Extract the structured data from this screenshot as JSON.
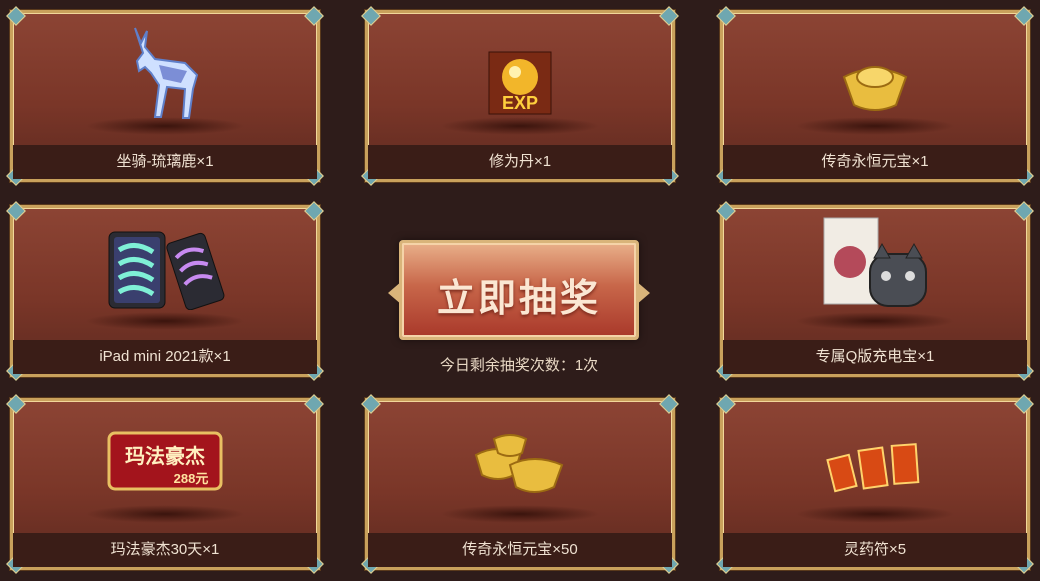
{
  "prizes": [
    {
      "label": "坐骑-琉璃鹿×1",
      "icon": "crystal-deer-icon"
    },
    {
      "label": "修为丹×1",
      "icon": "exp-pill-icon"
    },
    {
      "label": "传奇永恒元宝×1",
      "icon": "gold-ingot-icon"
    },
    {
      "label": "iPad mini 2021款×1",
      "icon": "ipad-mini-icon"
    },
    {
      "label": "专属Q版充电宝×1",
      "icon": "power-bank-icon"
    },
    {
      "label": "玛法豪杰30天×1",
      "icon": "title-badge-icon"
    },
    {
      "label": "传奇永恒元宝×50",
      "icon": "gold-ingot-pile-icon"
    },
    {
      "label": "灵药符×5",
      "icon": "talisman-icon"
    }
  ],
  "badge_text": {
    "title": "玛法豪杰",
    "price": "288元"
  },
  "exp_text": "EXP",
  "draw": {
    "button_label": "立即抽奖",
    "remaining_text": "今日剩余抽奖次数：1次"
  }
}
